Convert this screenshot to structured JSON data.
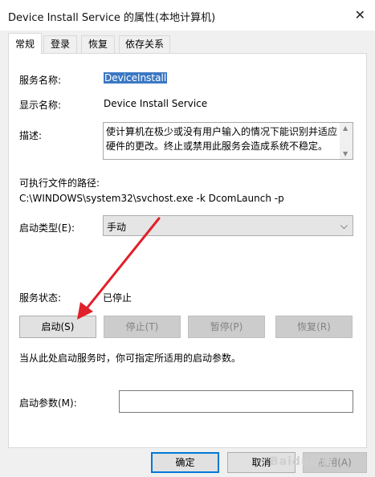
{
  "window": {
    "title": "Device Install Service 的属性(本地计算机)"
  },
  "tabs": [
    {
      "label": "常规",
      "active": true
    },
    {
      "label": "登录",
      "active": false
    },
    {
      "label": "恢复",
      "active": false
    },
    {
      "label": "依存关系",
      "active": false
    }
  ],
  "general": {
    "service_name_label": "服务名称:",
    "service_name_value": "DeviceInstall",
    "display_name_label": "显示名称:",
    "display_name_value": "Device Install Service",
    "description_label": "描述:",
    "description_value": "使计算机在极少或没有用户输入的情况下能识别并适应硬件的更改。终止或禁用此服务会造成系统不稳定。",
    "exe_path_label": "可执行文件的路径:",
    "exe_path_value": "C:\\WINDOWS\\system32\\svchost.exe -k DcomLaunch -p",
    "startup_type_label": "启动类型(E):",
    "startup_type_value": "手动",
    "service_status_label": "服务状态:",
    "service_status_value": "已停止",
    "start_button": "启动(S)",
    "stop_button": "停止(T)",
    "pause_button": "暂停(P)",
    "resume_button": "恢复(R)",
    "hint_text": "当从此处启动服务时，你可指定所适用的启动参数。",
    "start_params_label": "启动参数(M):",
    "start_params_value": ""
  },
  "footer": {
    "ok_button": "确定",
    "cancel_button": "取消",
    "apply_button": "应用(A)"
  },
  "annotation": {
    "arrow_color": "#e0202a"
  },
  "watermark": {
    "text": "Baidu经验"
  }
}
